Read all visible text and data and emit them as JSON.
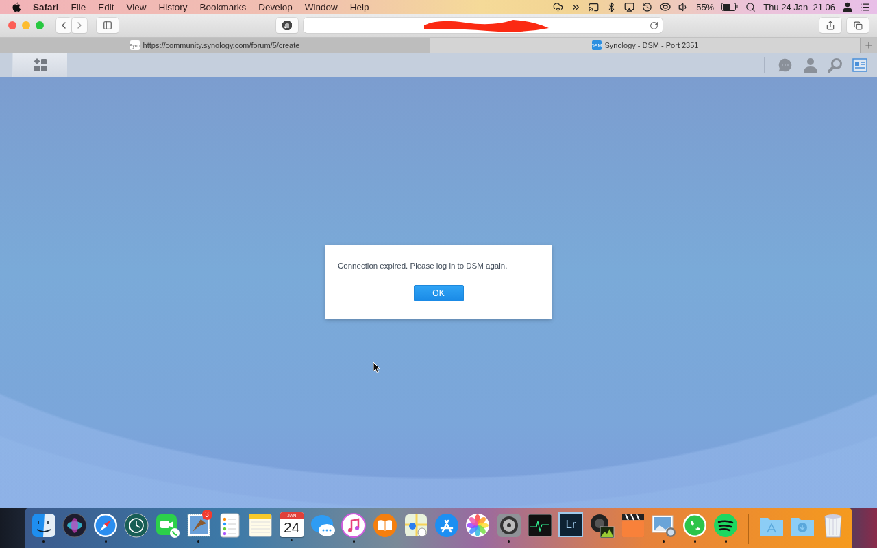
{
  "menu_bar": {
    "app_name": "Safari",
    "menus": [
      "File",
      "Edit",
      "View",
      "History",
      "Bookmarks",
      "Develop",
      "Window",
      "Help"
    ],
    "battery": "55%",
    "clock": "Thu 24 Jan  21 06"
  },
  "browser": {
    "tabs": [
      {
        "favicon": "Syno",
        "title": "https://community.synology.com/forum/5/create",
        "selected": false
      },
      {
        "favicon": "DSM",
        "title": "Synology - DSM - Port 2351",
        "selected": true
      }
    ]
  },
  "dialog": {
    "message": "Connection expired. Please log in to DSM again.",
    "button": "OK"
  },
  "dock": {
    "apps": [
      {
        "kind": "finder",
        "running": true
      },
      {
        "kind": "siri",
        "running": false
      },
      {
        "kind": "safari",
        "running": true
      },
      {
        "kind": "timemachine",
        "running": false
      },
      {
        "kind": "facetime",
        "running": false
      },
      {
        "kind": "mail",
        "badge": "3",
        "running": true
      },
      {
        "kind": "reminders",
        "running": false
      },
      {
        "kind": "notes",
        "running": false
      },
      {
        "kind": "calendar",
        "month": "JAN",
        "day": "24",
        "running": true
      },
      {
        "kind": "messages",
        "running": false
      },
      {
        "kind": "itunes",
        "running": true
      },
      {
        "kind": "books",
        "running": false
      },
      {
        "kind": "maps",
        "running": false
      },
      {
        "kind": "appstore",
        "running": false
      },
      {
        "kind": "photos",
        "running": false
      },
      {
        "kind": "preferences",
        "running": true
      },
      {
        "kind": "activity",
        "running": false
      },
      {
        "kind": "lightroom",
        "label": "Lr",
        "running": false
      },
      {
        "kind": "lens",
        "running": false
      },
      {
        "kind": "finalcut",
        "running": false
      },
      {
        "kind": "preview",
        "running": true
      },
      {
        "kind": "whatsapp",
        "running": true
      },
      {
        "kind": "spotify",
        "running": true
      }
    ],
    "stacks": [
      {
        "kind": "applications"
      },
      {
        "kind": "downloads"
      },
      {
        "kind": "trash"
      }
    ]
  }
}
